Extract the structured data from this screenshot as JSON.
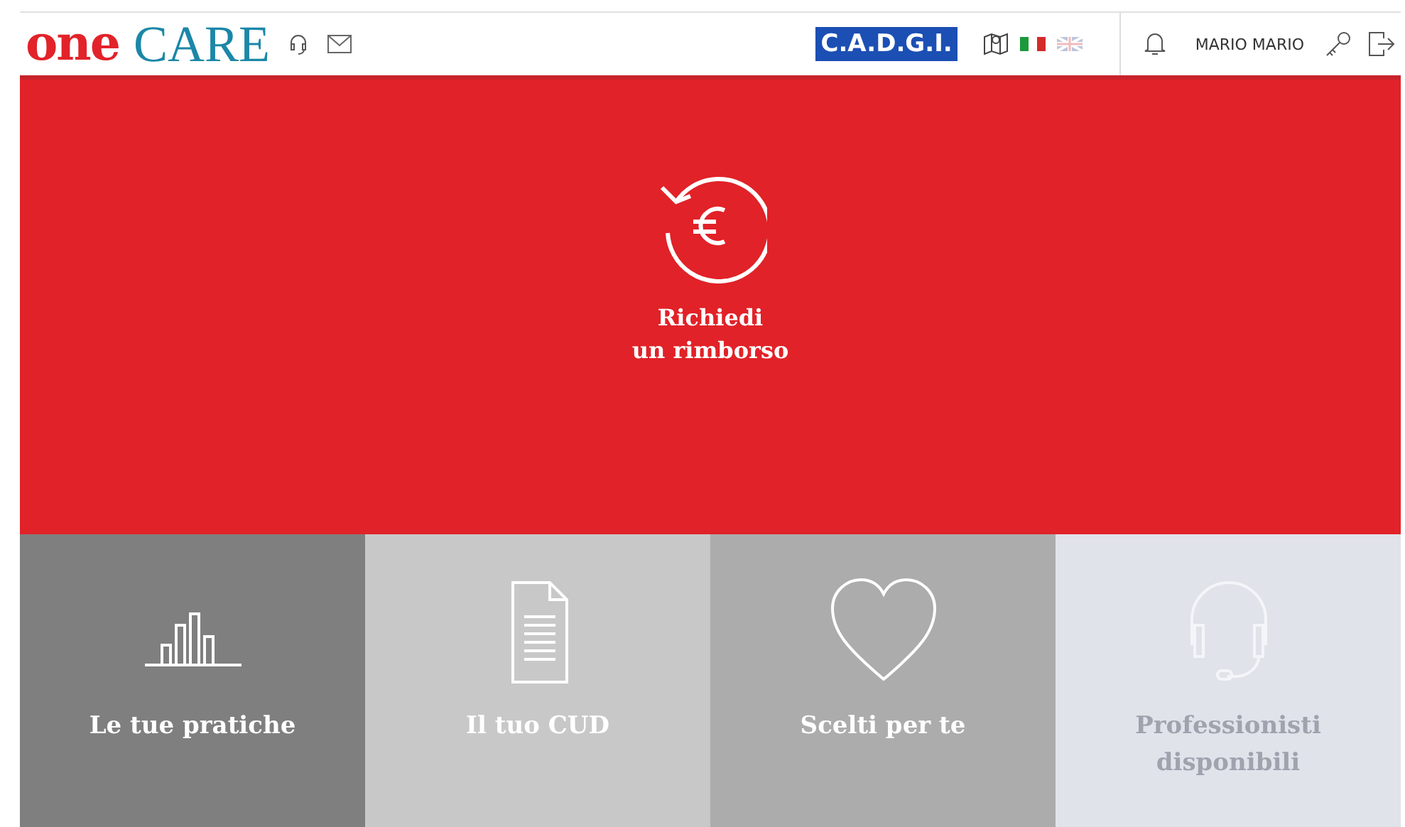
{
  "header": {
    "logo_bold": "one",
    "logo_light": "CARE",
    "partner": "C.A.D.G.I.",
    "languages": [
      {
        "kind": "italian",
        "selected": true
      },
      {
        "kind": "english",
        "selected": false
      }
    ],
    "user": "MARIO MARIO"
  },
  "hero": {
    "title": "Richiedi\nun rimborso"
  },
  "tiles": [
    {
      "kind": "chart",
      "label": "Le tue pratiche",
      "disabled": false
    },
    {
      "kind": "document",
      "label": "Il tuo CUD",
      "disabled": false
    },
    {
      "kind": "heart",
      "label": "Scelti per te",
      "disabled": false
    },
    {
      "kind": "headset",
      "label": "Professionisti disponibili",
      "disabled": true
    }
  ]
}
